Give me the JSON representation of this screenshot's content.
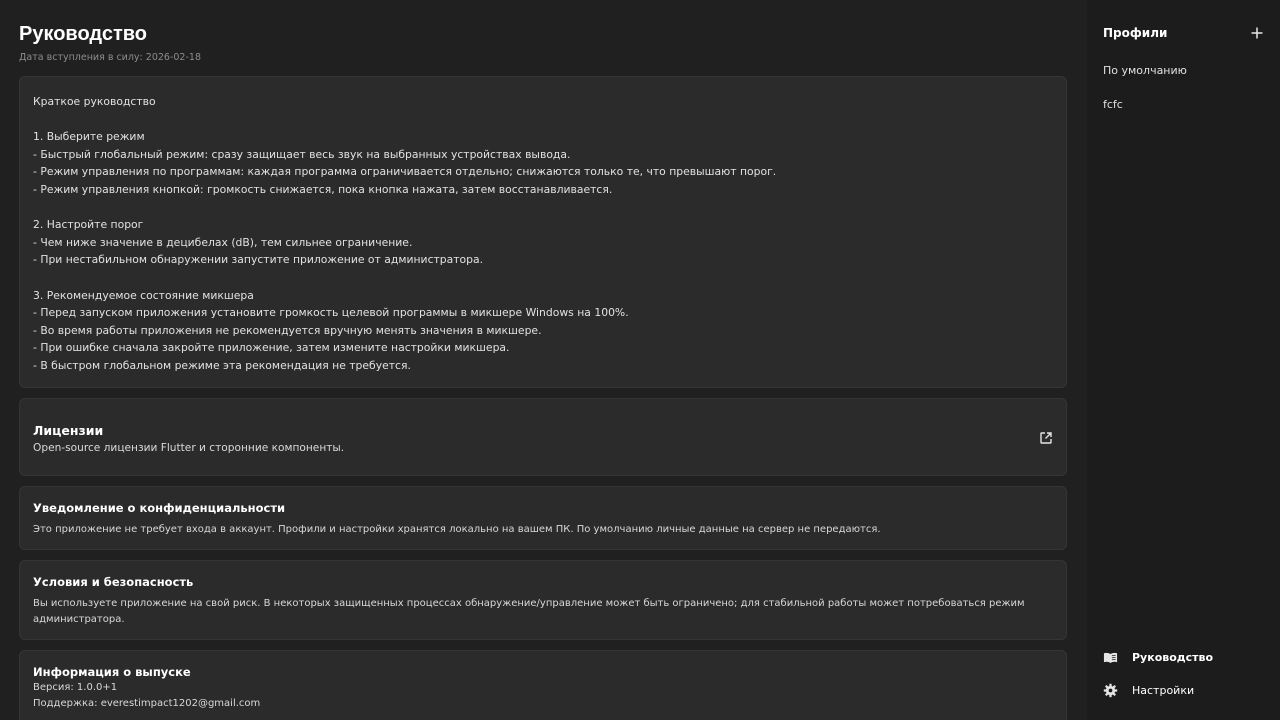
{
  "page": {
    "title": "Руководство",
    "subtitle": "Дата вступления в силу: 2026-02-18"
  },
  "guide": {
    "lines": [
      "Краткое руководство",
      "",
      "1. Выберите режим",
      "- Быстрый глобальный режим: сразу защищает весь звук на выбранных устройствах вывода.",
      "- Режим управления по программам: каждая программа ограничивается отдельно; снижаются только те, что превышают порог.",
      "- Режим управления кнопкой: громкость снижается, пока кнопка нажата, затем восстанавливается.",
      "",
      "2. Настройте порог",
      "- Чем ниже значение в децибелах (dB), тем сильнее ограничение.",
      "- При нестабильном обнаружении запустите приложение от администратора.",
      "",
      "3. Рекомендуемое состояние микшера",
      "- Перед запуском приложения установите громкость целевой программы в микшере Windows на 100%.",
      "- Во время работы приложения не рекомендуется вручную менять значения в микшере.",
      "- При ошибке сначала закройте приложение, затем измените настройки микшера.",
      "- В быстром глобальном режиме эта рекомендация не требуется."
    ]
  },
  "licenses": {
    "title": "Лицензии",
    "description": "Open-source лицензии Flutter и сторонние компоненты.",
    "icon": "open-in-new-icon"
  },
  "privacy": {
    "title": "Уведомление о конфиденциальности",
    "text": "Это приложение не требует входа в аккаунт. Профили и настройки хранятся локально на вашем ПК. По умолчанию личные данные на сервер не передаются."
  },
  "terms": {
    "title": "Условия и безопасность",
    "text": "Вы используете приложение на свой риск. В некоторых защищенных процессах обнаружение/управление может быть ограничено; для стабильной работы может потребоваться режим администратора."
  },
  "release": {
    "title": "Информация о выпуске",
    "version": "Версия: 1.0.0+1",
    "support": "Поддержка: everestimpact1202@gmail.com"
  },
  "sidebar": {
    "profiles_title": "Профили",
    "add_icon": "plus-icon",
    "profiles": [
      "По умолчанию",
      "fcfc"
    ],
    "nav": [
      {
        "label": "Руководство",
        "icon": "book-icon",
        "active": true
      },
      {
        "label": "Настройки",
        "icon": "gear-icon",
        "active": false
      }
    ]
  },
  "colors": {
    "background": "#202020",
    "card": "#2b2b2b",
    "sidebar": "#1c1c1c",
    "text": "#e6e6e6",
    "muted": "#8c8c8c"
  }
}
